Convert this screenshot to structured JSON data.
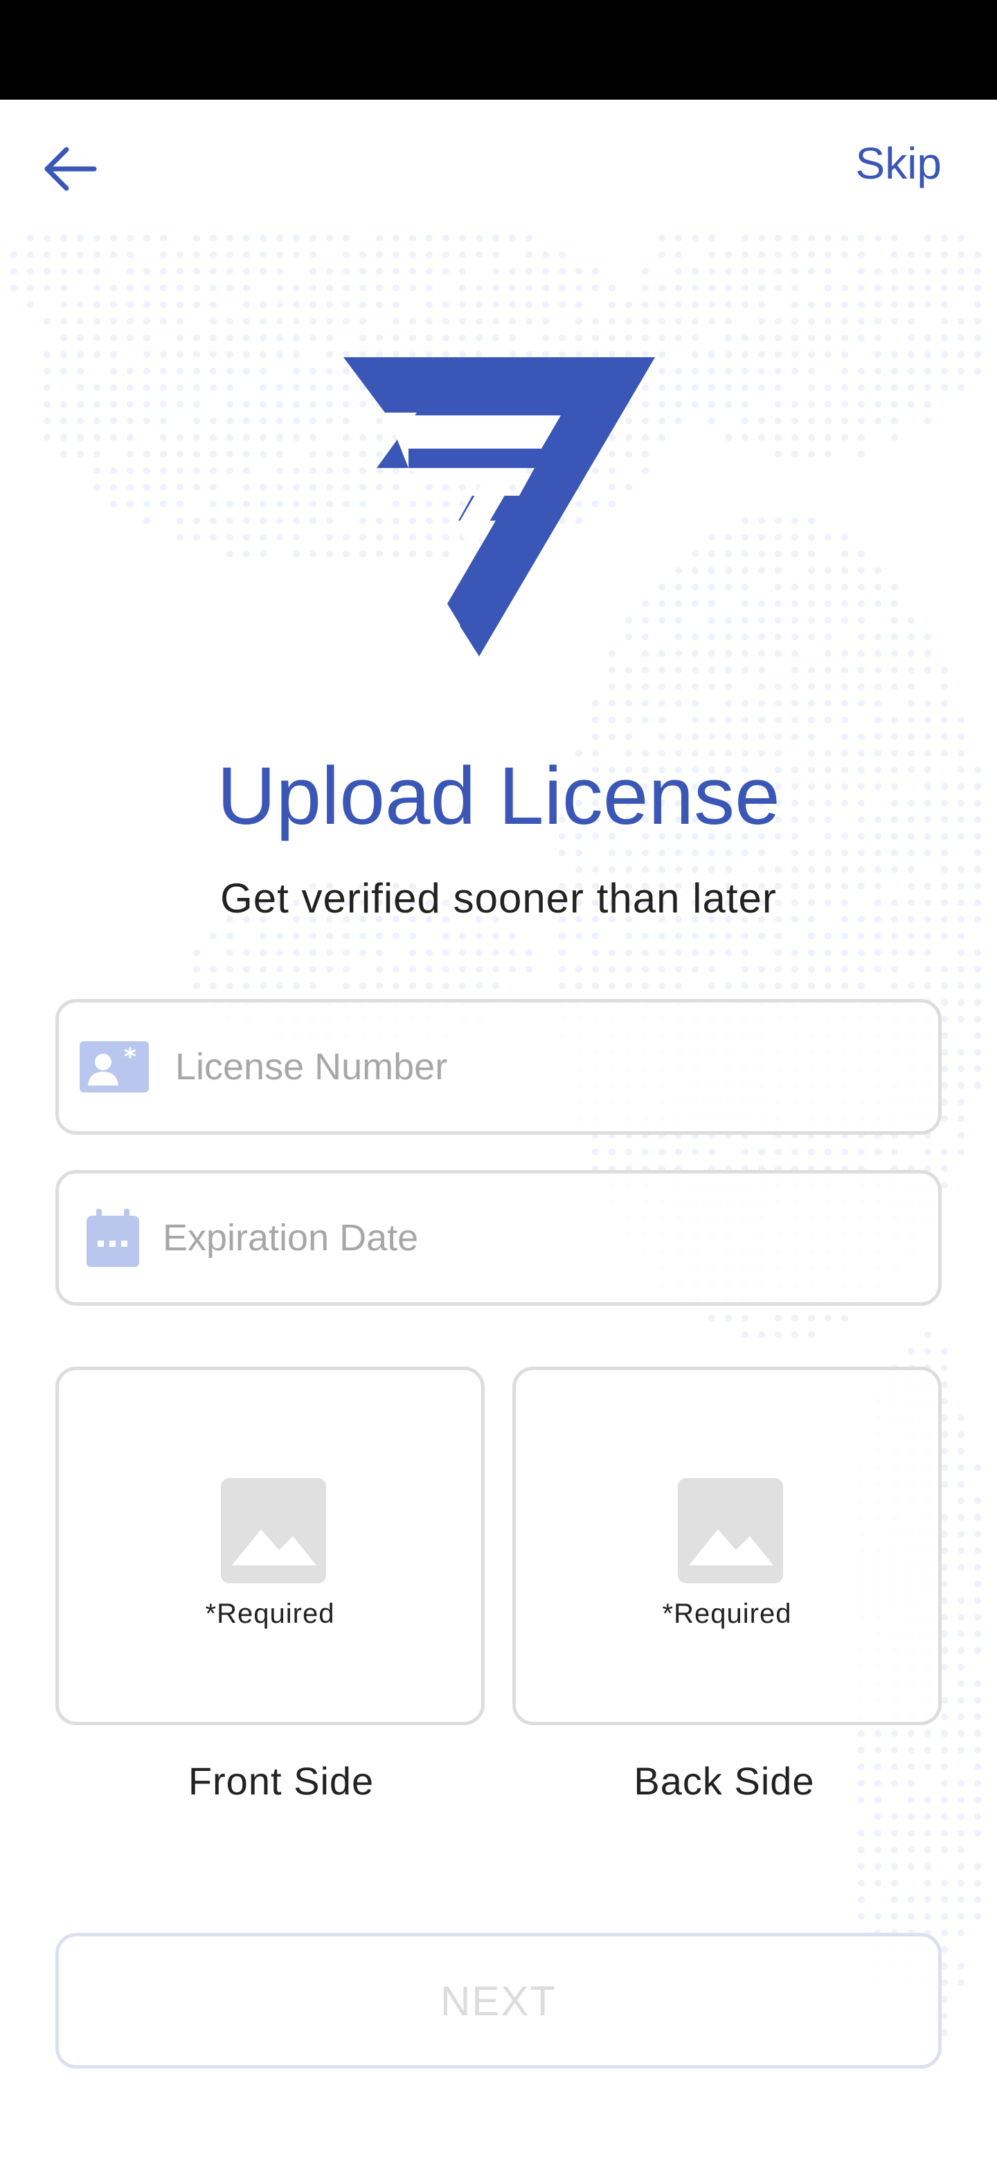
{
  "colors": {
    "accent": "#3a56b6",
    "field_border": "#dddddd",
    "placeholder": "#a7a7a7",
    "icon_light_blue": "#b9c7ef",
    "image_placeholder": "#e0e0e0",
    "disabled_text": "#dcdcdc"
  },
  "header": {
    "back_icon": "arrow-left-icon",
    "skip_label": "Skip"
  },
  "logo": {
    "icon": "brand-triangle-logo"
  },
  "title": "Upload License",
  "subtitle": "Get verified sooner than later",
  "form": {
    "license": {
      "icon": "id-card-icon",
      "placeholder": "License Number",
      "value": ""
    },
    "expiry": {
      "icon": "calendar-icon",
      "placeholder": "Expiration Date",
      "value": ""
    }
  },
  "uploads": {
    "front": {
      "icon": "image-placeholder-icon",
      "required": "*Required",
      "label": "Front Side"
    },
    "back": {
      "icon": "image-placeholder-icon",
      "required": "*Required",
      "label": "Back Side"
    }
  },
  "next_label": "NEXT"
}
